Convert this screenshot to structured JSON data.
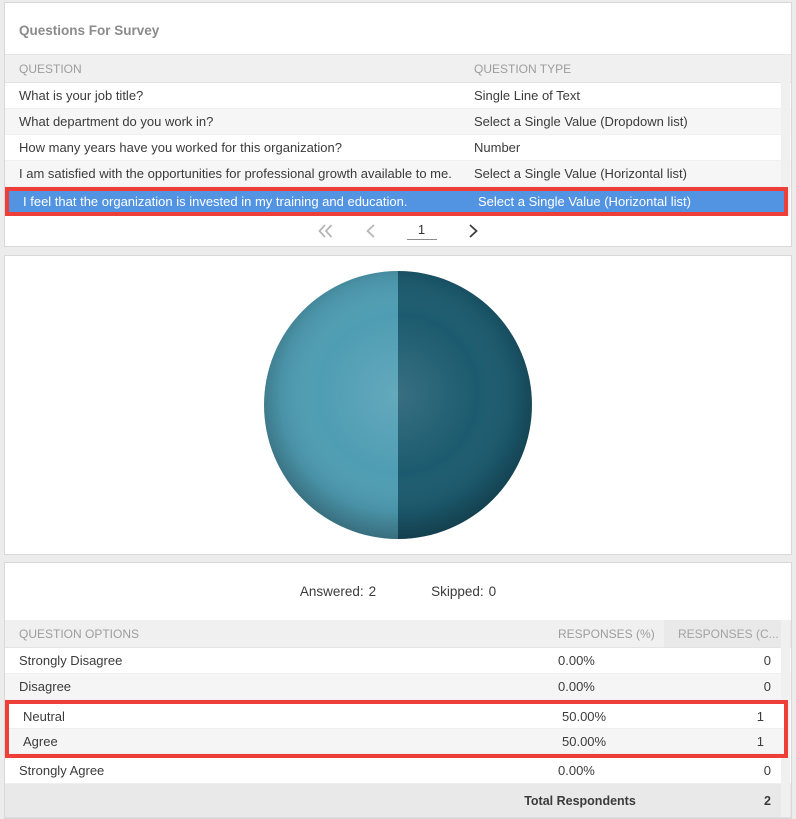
{
  "colors": {
    "accent_blue": "#5294e2",
    "highlight_red": "#ee3e38",
    "pie_left": "#4f9db3",
    "pie_right": "#1c5b6f",
    "page_bg": "#ececec",
    "header_text": "#9d9d9d",
    "body_text": "#3b3b3b"
  },
  "questions_panel": {
    "title": "Questions For Survey",
    "columns": [
      "QUESTION",
      "QUESTION TYPE"
    ],
    "rows": [
      {
        "question": "What is your job title?",
        "type": "Single Line of Text",
        "selected": false
      },
      {
        "question": "What department do you work in?",
        "type": "Select a Single Value (Dropdown list)",
        "selected": false
      },
      {
        "question": "How many years have you worked for this organization?",
        "type": "Number",
        "selected": false
      },
      {
        "question": "I am satisfied with the opportunities for professional growth available to me.",
        "type": "Select a Single Value (Horizontal list)",
        "selected": false
      },
      {
        "question": "I feel that the organization is invested in my training and education.",
        "type": "Select a Single Value (Horizontal list)",
        "selected": true
      }
    ],
    "pagination": {
      "current_page": "1",
      "icons": [
        "first-page-icon",
        "previous-page-icon",
        "next-page-icon"
      ]
    }
  },
  "chart_data": {
    "type": "pie",
    "title": "",
    "categories": [
      "Strongly Disagree",
      "Disagree",
      "Neutral",
      "Agree",
      "Strongly Agree"
    ],
    "values": [
      0,
      0,
      50,
      50,
      0
    ],
    "unit": "percent",
    "slices": [
      {
        "label": "Neutral",
        "value": 50,
        "color": "#4f9db3"
      },
      {
        "label": "Agree",
        "value": 50,
        "color": "#1c5b6f"
      }
    ],
    "legend": "none",
    "data_labels": "none",
    "layout": "3D-shaded pie; Neutral = left half (light teal), Agree = right half (dark teal), split vertical at 12 o'clock"
  },
  "summary": {
    "answered_label": "Answered:",
    "answered_value": "2",
    "skipped_label": "Skipped:",
    "skipped_value": "0"
  },
  "options_table": {
    "columns": [
      "QUESTION OPTIONS",
      "RESPONSES (%)",
      "RESPONSES (C..."
    ],
    "rows": [
      {
        "label": "Strongly Disagree",
        "pct": "0.00%",
        "count": "0",
        "highlighted": false
      },
      {
        "label": "Disagree",
        "pct": "0.00%",
        "count": "0",
        "highlighted": false
      },
      {
        "label": "Neutral",
        "pct": "50.00%",
        "count": "1",
        "highlighted": true
      },
      {
        "label": "Agree",
        "pct": "50.00%",
        "count": "1",
        "highlighted": true
      },
      {
        "label": "Strongly Agree",
        "pct": "0.00%",
        "count": "0",
        "highlighted": false
      }
    ],
    "total": {
      "label": "Total Respondents",
      "count": "2"
    }
  }
}
